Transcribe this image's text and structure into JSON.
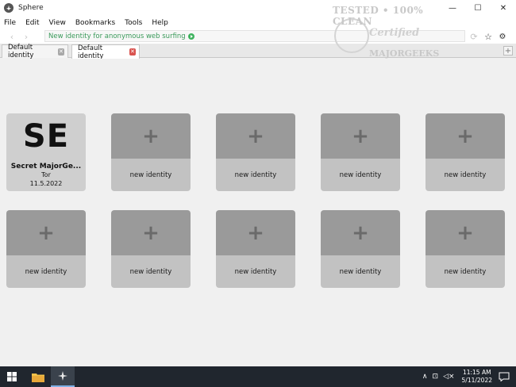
{
  "window": {
    "title": "Sphere",
    "controls": {
      "minimize": "—",
      "maximize": "☐",
      "close": "✕"
    }
  },
  "menu": [
    "File",
    "Edit",
    "View",
    "Bookmarks",
    "Tools",
    "Help"
  ],
  "nav": {
    "back": "‹",
    "forward": "›",
    "url_text": "New identity for anonymous web surfing",
    "refresh": "⟳",
    "bookmark": "☆",
    "settings": "⚙"
  },
  "tabs": [
    {
      "label": "Default identity",
      "close": "✕",
      "active": false
    },
    {
      "label": "Default identity",
      "close": "✕",
      "active": true
    }
  ],
  "new_tab": "+",
  "identities": {
    "existing": {
      "initials": "SE",
      "name": "Secret MajorGe...",
      "browser": "Tor",
      "date": "11.5.2022"
    },
    "plus": "+",
    "new_label": "new identity"
  },
  "watermark": {
    "line1": "TESTED • 100% CLEAN",
    "line2": "Certified",
    "line3": "MAJORGEEKS"
  },
  "taskbar": {
    "time": "11:15 AM",
    "date": "5/11/2022",
    "tray_up": "∧",
    "tray_network": "⊡",
    "tray_volume": "◁×"
  },
  "colors": {
    "url_green": "#3a9a5a",
    "tab_close_active": "#d9534f",
    "card_top": "#9a9a9a",
    "card_bottom": "#c2c2c2",
    "taskbar": "#20262e"
  }
}
